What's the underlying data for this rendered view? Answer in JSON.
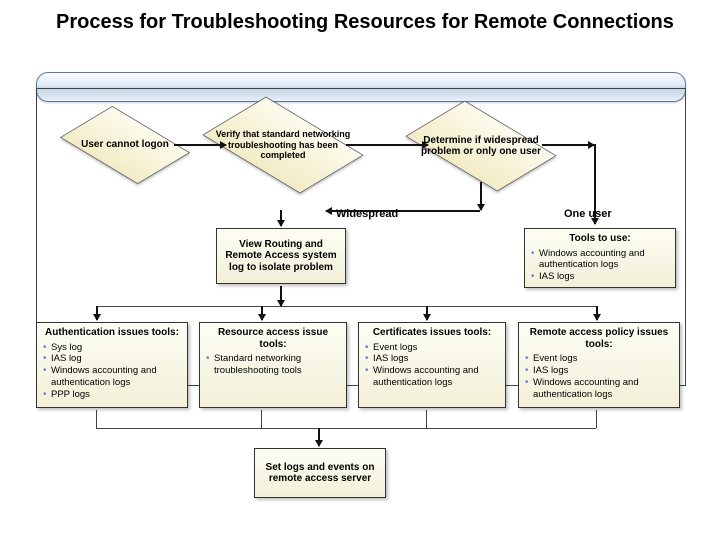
{
  "title": "Process for Troubleshooting Resources for Remote Connections",
  "diamonds": {
    "start": "User cannot logon",
    "verify": "Verify that standard networking troubleshooting has been completed",
    "determine": "Determine if widespread problem or only one user"
  },
  "paths": {
    "widespread": "Widespread",
    "one_user": "One user"
  },
  "boxes": {
    "view_rra": {
      "head": "View Routing and Remote Access system log to isolate problem"
    },
    "tools_to_use": {
      "head": "Tools to use:",
      "items": [
        "Windows accounting and authentication logs",
        "IAS logs"
      ]
    },
    "auth": {
      "head": "Authentication issues tools:",
      "items": [
        "Sys log",
        "IAS log",
        "Windows accounting and authentication logs",
        "PPP logs"
      ]
    },
    "resource": {
      "head": "Resource access issue tools:",
      "items": [
        "Standard networking troubleshooting tools"
      ]
    },
    "certs": {
      "head": "Certificates issues tools:",
      "items": [
        "Event logs",
        "IAS logs",
        "Windows accounting and authentication logs"
      ]
    },
    "rap": {
      "head": "Remote access policy issues tools:",
      "items": [
        "Event logs",
        "IAS logs",
        "Windows accounting and authentication logs"
      ]
    },
    "set_logs": {
      "head": "Set logs and events on remote access server"
    }
  }
}
